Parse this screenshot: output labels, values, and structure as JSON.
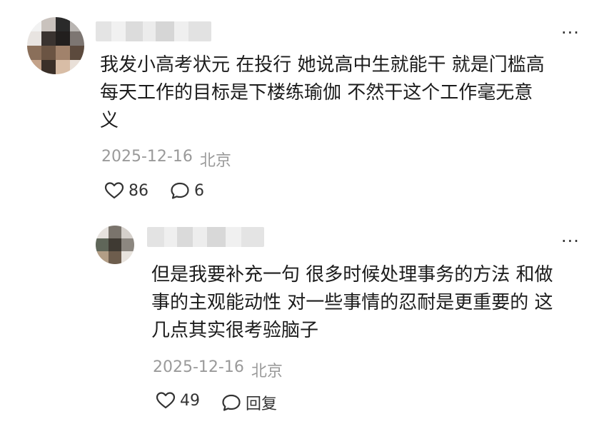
{
  "comments": [
    {
      "lines": [
        "我发小高考状元 在投行 她说高中生就能干 就是门槛高",
        "每天工作的目标是下楼练瑜伽 不然干这个工作毫无意",
        "义"
      ],
      "date": "2025-12-16",
      "location": "北京",
      "likes": "86",
      "replies": "6",
      "more": "···"
    },
    {
      "lines": [
        "但是我要补充一句 很多时候处理事务的方法 和做",
        "事的主观能动性 对一些事情的忍耐是更重要的 这",
        "几点其实很考验脑子"
      ],
      "date": "2025-12-16",
      "location": "北京",
      "likes": "49",
      "reply_label": "回复",
      "more": "···"
    }
  ],
  "icons": {
    "like": "heart-outline-icon",
    "comment": "speech-bubble-icon"
  }
}
